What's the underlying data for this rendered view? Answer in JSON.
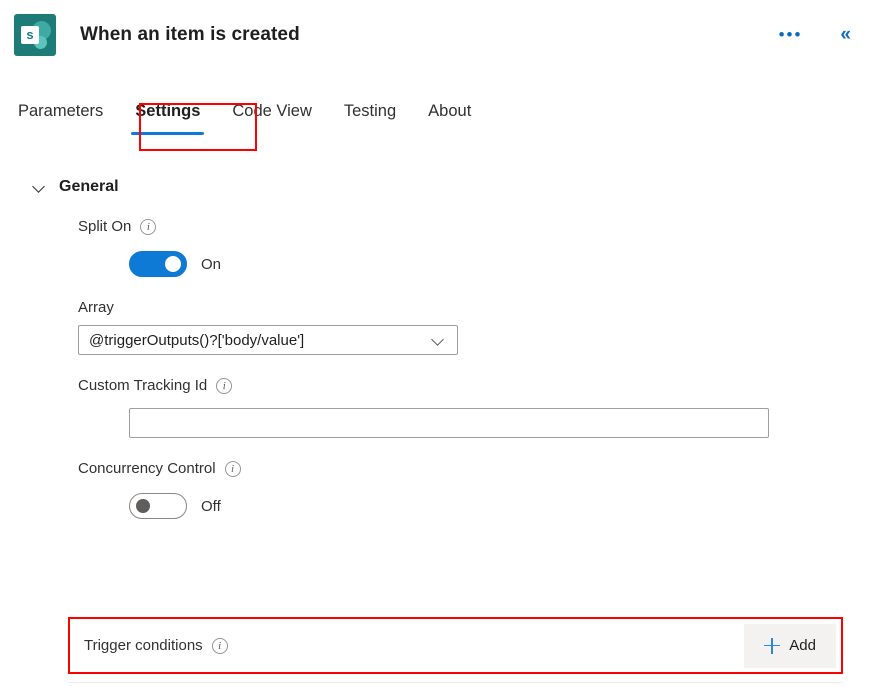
{
  "header": {
    "app_icon": "sharepoint-icon",
    "app_icon_letter": "s",
    "title": "When an item is created",
    "more_options_icon": "ellipsis-icon",
    "more_options_glyph": "•••",
    "collapse_icon": "double-chevron-left-icon",
    "collapse_glyph": "«"
  },
  "tabs": [
    {
      "label": "Parameters",
      "active": false
    },
    {
      "label": "Settings",
      "active": true
    },
    {
      "label": "Code View",
      "active": false
    },
    {
      "label": "Testing",
      "active": false
    },
    {
      "label": "About",
      "active": false
    }
  ],
  "section": {
    "title": "General",
    "expanded": true,
    "chevron_icon": "chevron-down-icon"
  },
  "fields": {
    "split_on": {
      "label": "Split On",
      "info_icon": "info-icon",
      "info_glyph": "i",
      "toggle_state": "On",
      "toggle_on": true
    },
    "array": {
      "label": "Array",
      "value": "@triggerOutputs()?['body/value']",
      "chevron_icon": "chevron-down-icon"
    },
    "custom_tracking_id": {
      "label": "Custom Tracking Id",
      "info_icon": "info-icon",
      "info_glyph": "i",
      "value": "",
      "placeholder": ""
    },
    "concurrency_control": {
      "label": "Concurrency Control",
      "info_icon": "info-icon",
      "info_glyph": "i",
      "toggle_state": "Off",
      "toggle_on": false
    },
    "trigger_conditions": {
      "label": "Trigger conditions",
      "info_icon": "info-icon",
      "info_glyph": "i",
      "add_label": "Add",
      "add_icon": "plus-icon"
    }
  },
  "annotations": {
    "color": "#ff0000",
    "settings_tab_highlight": "Settings",
    "trigger_conditions_highlight": "Trigger conditions"
  },
  "colors": {
    "accent_blue": "#0f7ad6",
    "link_blue": "#0f6cbd",
    "sharepoint_teal": "#1d7b78",
    "annotation_red": "#ff0000",
    "button_bg": "#f3f2f1"
  }
}
